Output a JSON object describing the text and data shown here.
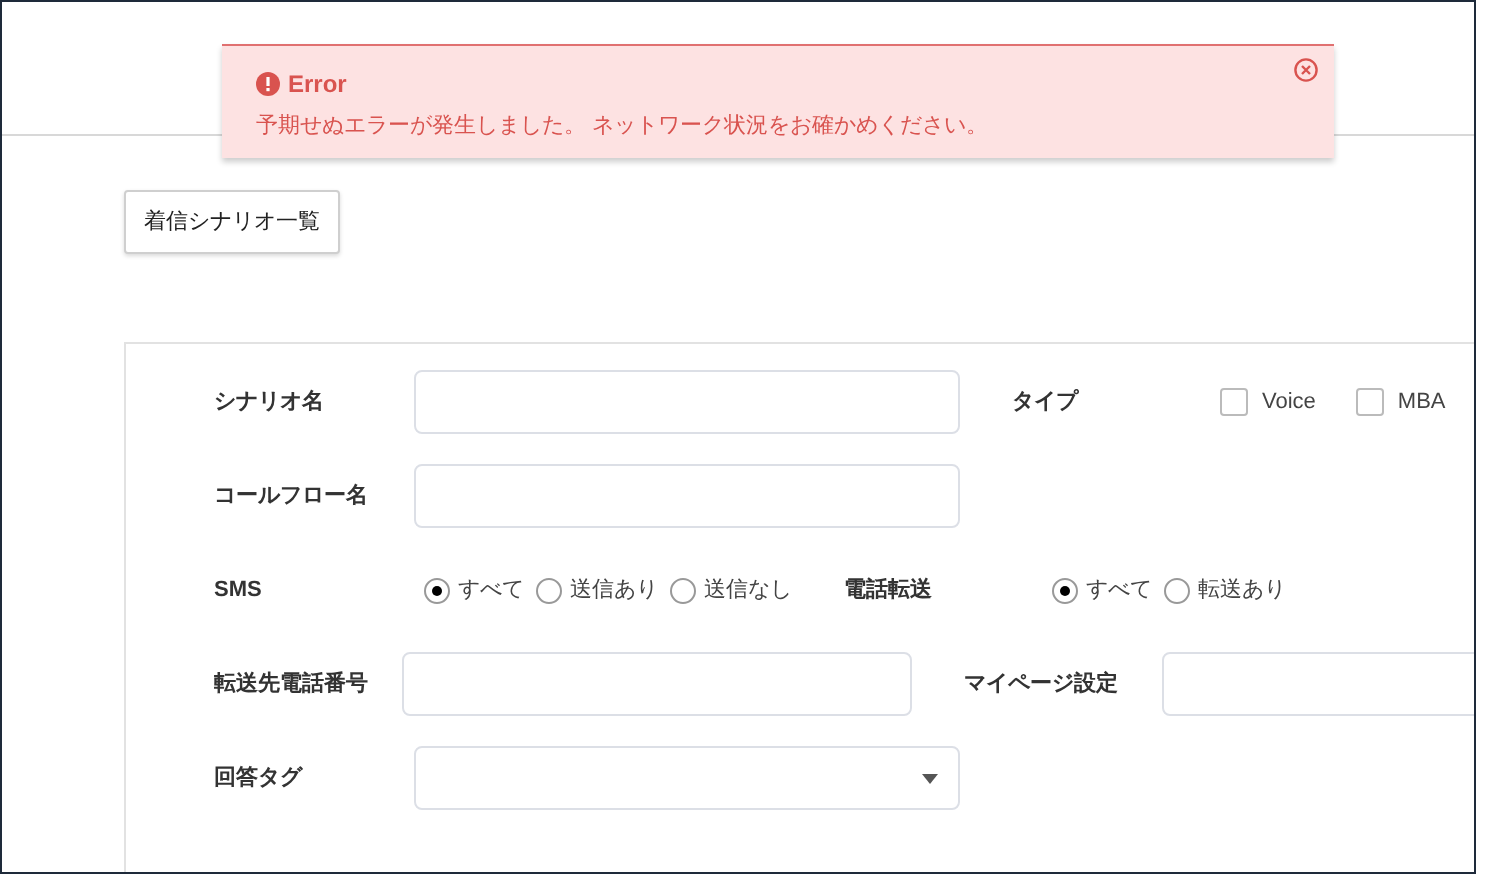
{
  "alert": {
    "title": "Error",
    "message": "予期せぬエラーが発生しました。 ネットワーク状況をお確かめください。"
  },
  "list_button": {
    "label": "着信シナリオ一覧"
  },
  "rows": [
    {
      "left": {
        "kind": "text",
        "label": "シナリオ名"
      },
      "right": {
        "kind": "checkboxes",
        "label": "タイプ",
        "options": [
          {
            "label": "Voice",
            "checked": false
          },
          {
            "label": "MBA",
            "checked": false
          }
        ]
      }
    },
    {
      "left": {
        "kind": "text",
        "label": "コールフロー名"
      }
    },
    {
      "left": {
        "kind": "radios",
        "label": "SMS",
        "options": [
          {
            "label": "すべて",
            "selected": true
          },
          {
            "label": "送信あり",
            "selected": false
          },
          {
            "label": "送信なし",
            "selected": false
          }
        ]
      },
      "right": {
        "kind": "radios",
        "label": "電話転送",
        "options": [
          {
            "label": "すべて",
            "selected": true
          },
          {
            "label": "転送あり",
            "selected": false
          }
        ]
      }
    },
    {
      "left": {
        "kind": "text",
        "label": "転送先電話番号"
      },
      "right": {
        "kind": "text",
        "label": "マイページ設定"
      }
    },
    {
      "left": {
        "kind": "select",
        "label": "回答タグ"
      }
    }
  ]
}
